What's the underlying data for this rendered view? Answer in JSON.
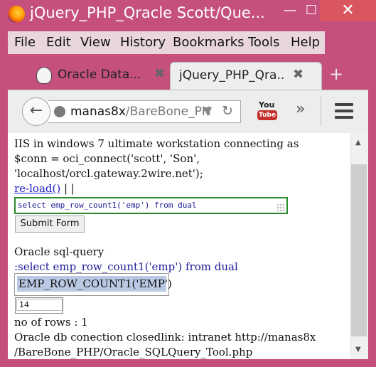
{
  "window": {
    "title": "jQuery_PHP_Qracle Scott/Que...",
    "minimize_glyph": "—",
    "maximize_glyph": "☐",
    "close_glyph": "✕",
    "app_icon": "firefox-icon"
  },
  "menubar": {
    "items": [
      "File",
      "Edit",
      "View",
      "History",
      "Bookmarks",
      "Tools",
      "Help"
    ]
  },
  "tabs": [
    {
      "label": "Oracle Data...",
      "favicon": "oracle-favicon-icon",
      "active": false
    },
    {
      "label": "jQuery_PHP_Qra...",
      "active": true
    }
  ],
  "tab_close_glyph": "✖",
  "new_tab_glyph": "+",
  "navbar": {
    "back_glyph": "←",
    "url_host": "manas8x",
    "url_path": "/BareBone_PH",
    "dropdown_glyph": "▼",
    "reload_glyph": "↻",
    "youtube_you": "You",
    "youtube_tube": "Tube",
    "overflow_glyph": "»"
  },
  "page": {
    "line_iis": "IIS in windows 7 ultimate workstation connecting as",
    "line_conn": "$conn = oci_connect('scott', 'Son',",
    "line_host": "'localhost/orcl.gateway.2wire.net');",
    "reload_link": "re-load()",
    "reload_sep": " | |",
    "query_value": "select emp_row_count1('emp') from dual",
    "submit_label": "Submit Form",
    "oracle_heading": "Oracle sql-query",
    "query_echo": ":select emp_row_count1('emp') from dual",
    "column_header": "EMP_ROW_COUNT1('EMP')",
    "result_value": "14",
    "rows_line": "no of rows : 1",
    "closed_line": "Oracle db conection closedlink: intranet http://manas8x",
    "path_line": "/BareBone_PHP/Oracle_SQLQuery_Tool.php"
  },
  "scrollbar": {
    "up_glyph": "▲",
    "down_glyph": "▼"
  },
  "colors": {
    "window_frame": "#c5507d",
    "close_button": "#d9565f",
    "link": "#1a1acc",
    "query_border": "#2d8a2d",
    "column_header_bg": "#b9c9e3"
  }
}
